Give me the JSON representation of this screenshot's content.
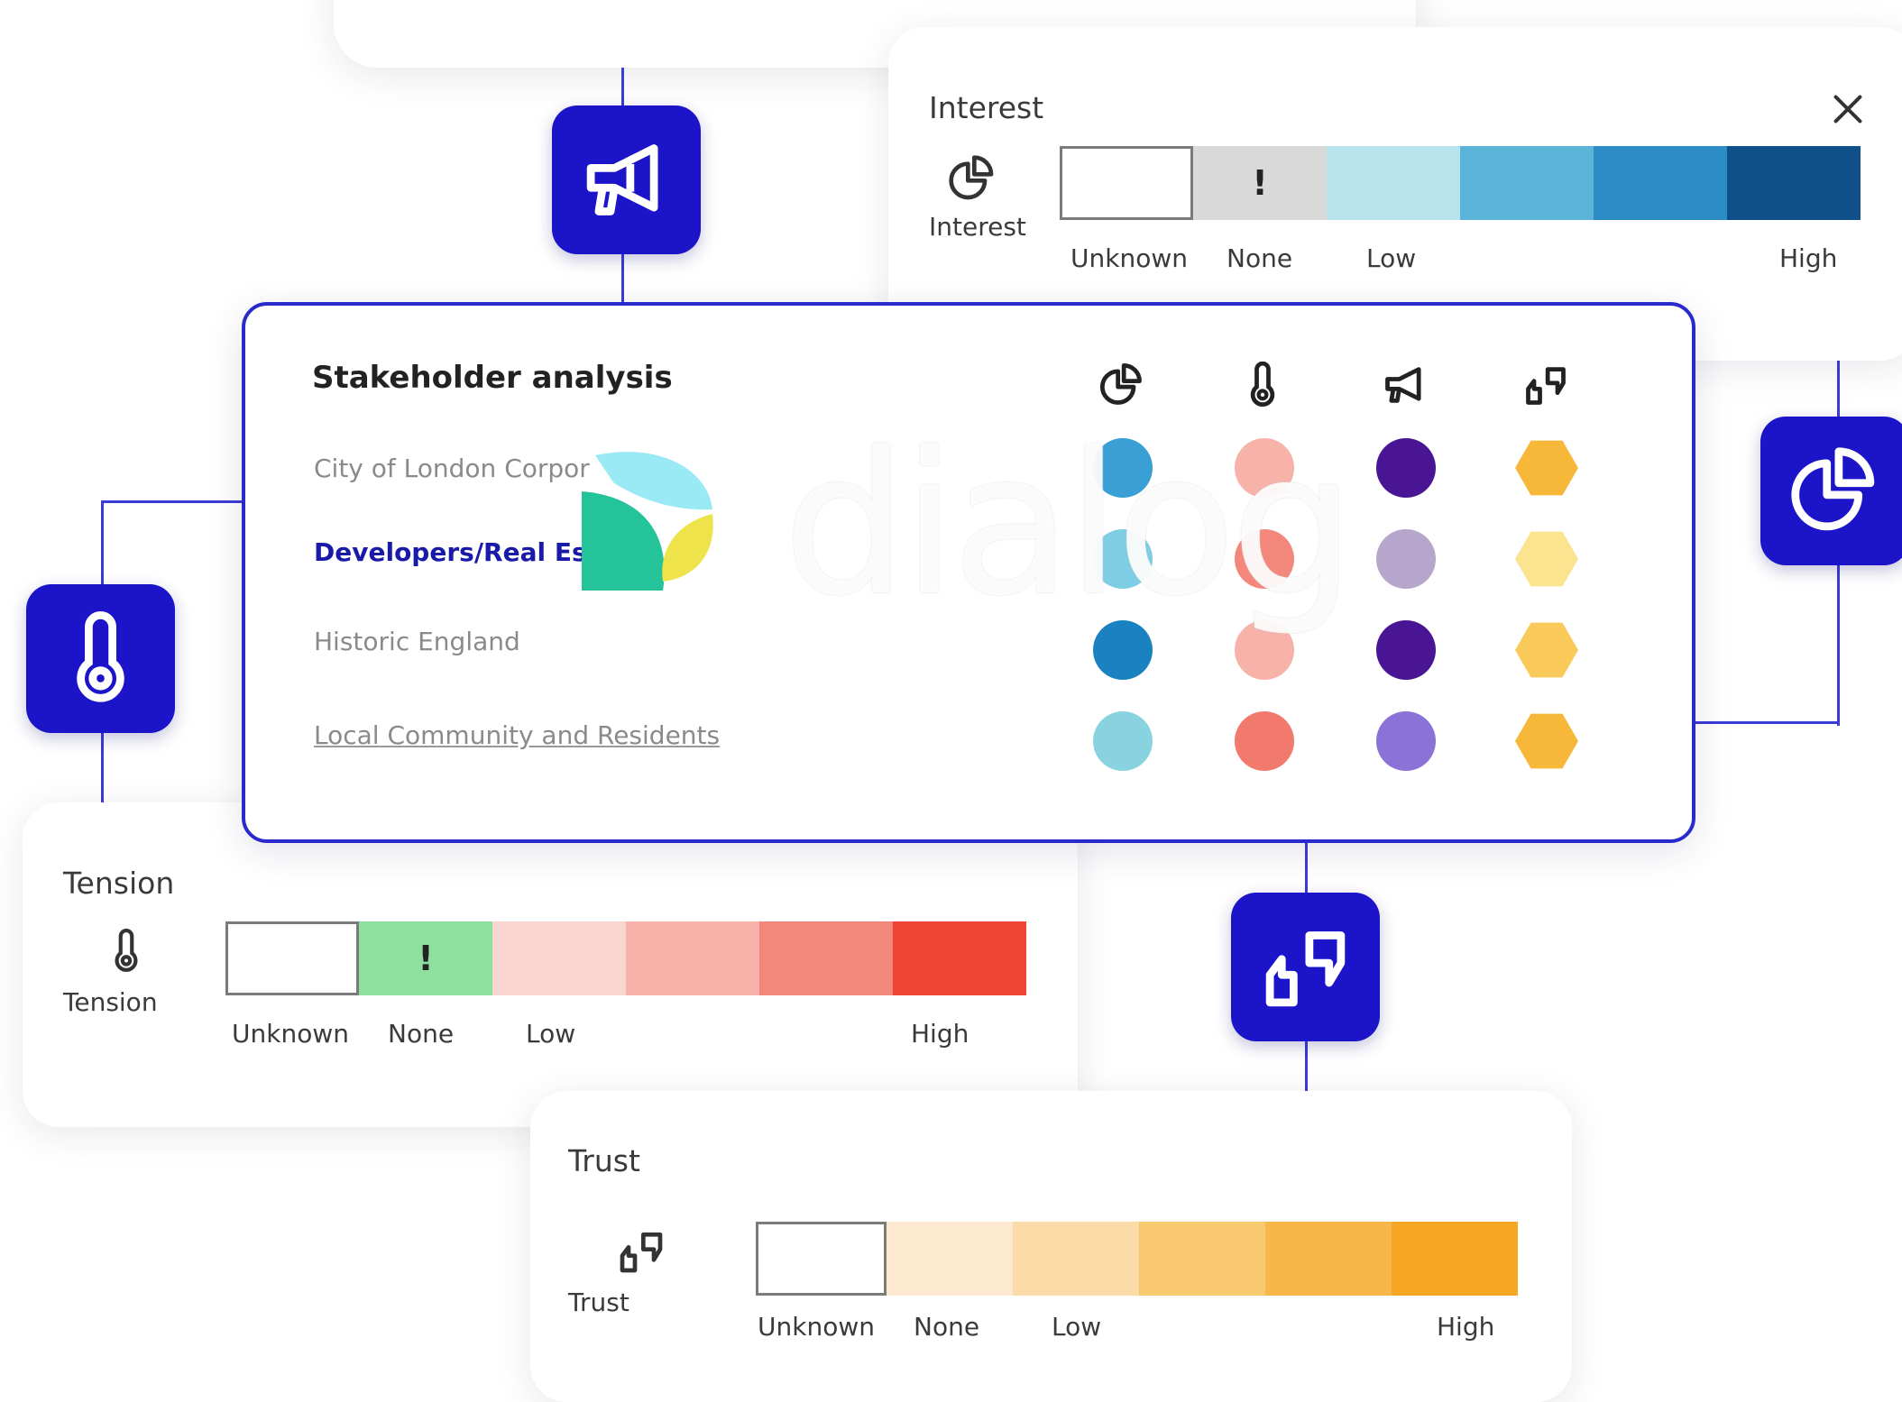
{
  "interest_panel": {
    "title": "Interest",
    "side_label": "Interest",
    "scale_labels": {
      "unknown": "Unknown",
      "none": "None",
      "low": "Low",
      "high": "High"
    },
    "none_marker": "!",
    "colors": [
      "#d9d9d9",
      "#b8e2ec",
      "#5bb4d8",
      "#2b8cc6",
      "#0f4f8a"
    ]
  },
  "tension_panel": {
    "title": "Tension",
    "side_label": "Tension",
    "scale_labels": {
      "unknown": "Unknown",
      "none": "None",
      "low": "Low",
      "high": "High"
    },
    "none_marker": "!",
    "colors": [
      "#8fe0a0",
      "#fad6d0",
      "#f7b2aa",
      "#f4877c",
      "#f04432"
    ]
  },
  "trust_panel": {
    "title": "Trust",
    "side_label": "Trust",
    "scale_labels": {
      "unknown": "Unknown",
      "none": "None",
      "low": "Low",
      "high": "High"
    },
    "colors": [
      "#fde9cf",
      "#fbdba8",
      "#f9c970",
      "#f7b74a",
      "#f5a623"
    ]
  },
  "stakeholder_analysis": {
    "title": "Stakeholder analysis",
    "rows": [
      {
        "label": "City of London Corpor",
        "interest": "#3a9fd4",
        "tension": "#f7b2aa",
        "influence": "#4a1595",
        "trust": "#f7b83a"
      },
      {
        "label": "Developers/Real Esta",
        "interest": "#7fcde5",
        "tension": "#f4877c",
        "influence": "#b7a6cc",
        "trust": "#fbe38f"
      },
      {
        "label": "Historic England",
        "interest": "#1a82c0",
        "tension": "#f7b2aa",
        "influence": "#4a1595",
        "trust": "#f9c95a"
      },
      {
        "label": "Local Community and Residents",
        "interest": "#89d3e1",
        "tension": "#f17a6c",
        "influence": "#8a72d6",
        "trust": "#f7b83a"
      }
    ]
  },
  "brand": {
    "logo_text": "dialog",
    "tile_color": "#1b14c8",
    "accent": "#2a2acc"
  }
}
